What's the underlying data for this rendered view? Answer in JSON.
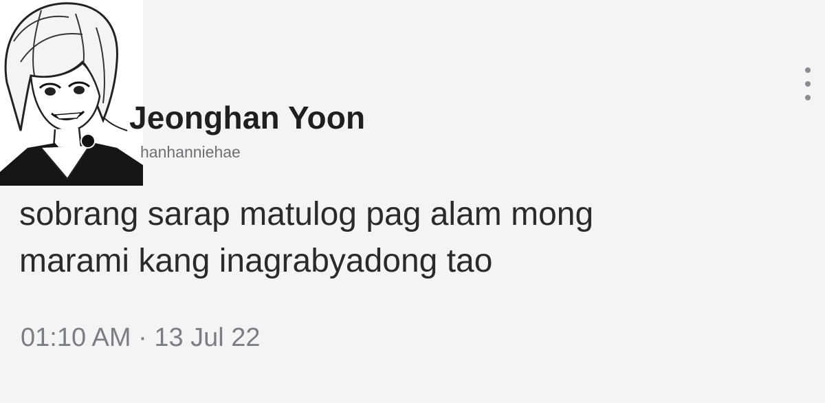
{
  "tweet": {
    "display_name": "Jeonghan Yoon",
    "handle": "hanhanniehae",
    "text_lines": [
      "sobrang sarap matulog pag alam mong",
      "marami kang inagrabyadong tao"
    ],
    "time": "01:10 AM",
    "separator": "·",
    "date": "13 Jul 22"
  },
  "icons": {
    "avatar": "manga-character-portrait",
    "menu": "more-vertical-icon"
  },
  "colors": {
    "background": "#f3f4f5",
    "name": "#1f1f1f",
    "secondary": "#7a7d82"
  }
}
